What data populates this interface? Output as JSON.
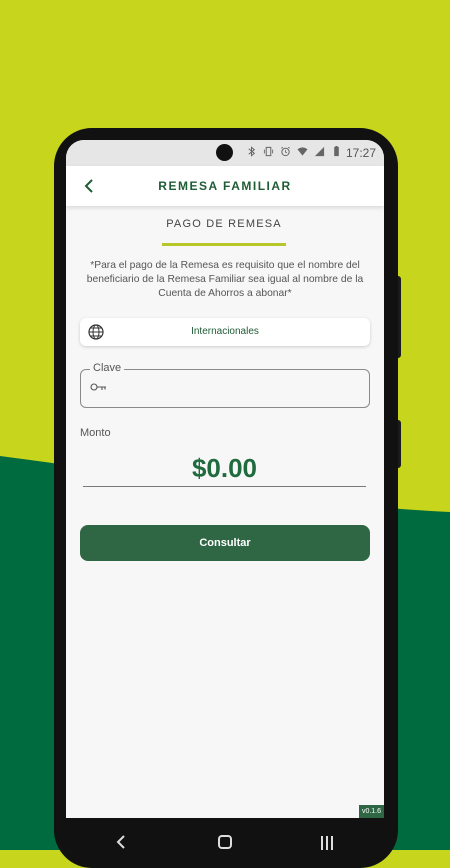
{
  "theme": {
    "lime": "#c7d61c",
    "green": "#006b3f",
    "button": "#2f6744",
    "accent": "#b6c62b"
  },
  "status_bar": {
    "time": "17:27",
    "icons": [
      "bluetooth-icon",
      "vibrate-icon",
      "alarm-icon",
      "wifi-icon",
      "signal-icon",
      "battery-icon"
    ]
  },
  "header": {
    "title": "REMESA FAMILIAR",
    "back_icon": "chevron-left-icon"
  },
  "tab": {
    "label": "PAGO DE REMESA"
  },
  "note": "*Para el pago de la Remesa es requisito que el nombre del beneficiario de la Remesa Familiar sea igual al nombre de la Cuenta de Ahorros a abonar*",
  "remittance_type": {
    "icon": "globe-icon",
    "value": "Internacionales"
  },
  "clave": {
    "label": "Clave",
    "icon": "key-icon",
    "value": ""
  },
  "monto": {
    "label": "Monto",
    "value": "$0.00"
  },
  "actions": {
    "submit_label": "Consultar"
  },
  "version": "v0.1.6",
  "nav": [
    "back-nav-icon",
    "home-nav-icon",
    "recents-nav-icon"
  ]
}
